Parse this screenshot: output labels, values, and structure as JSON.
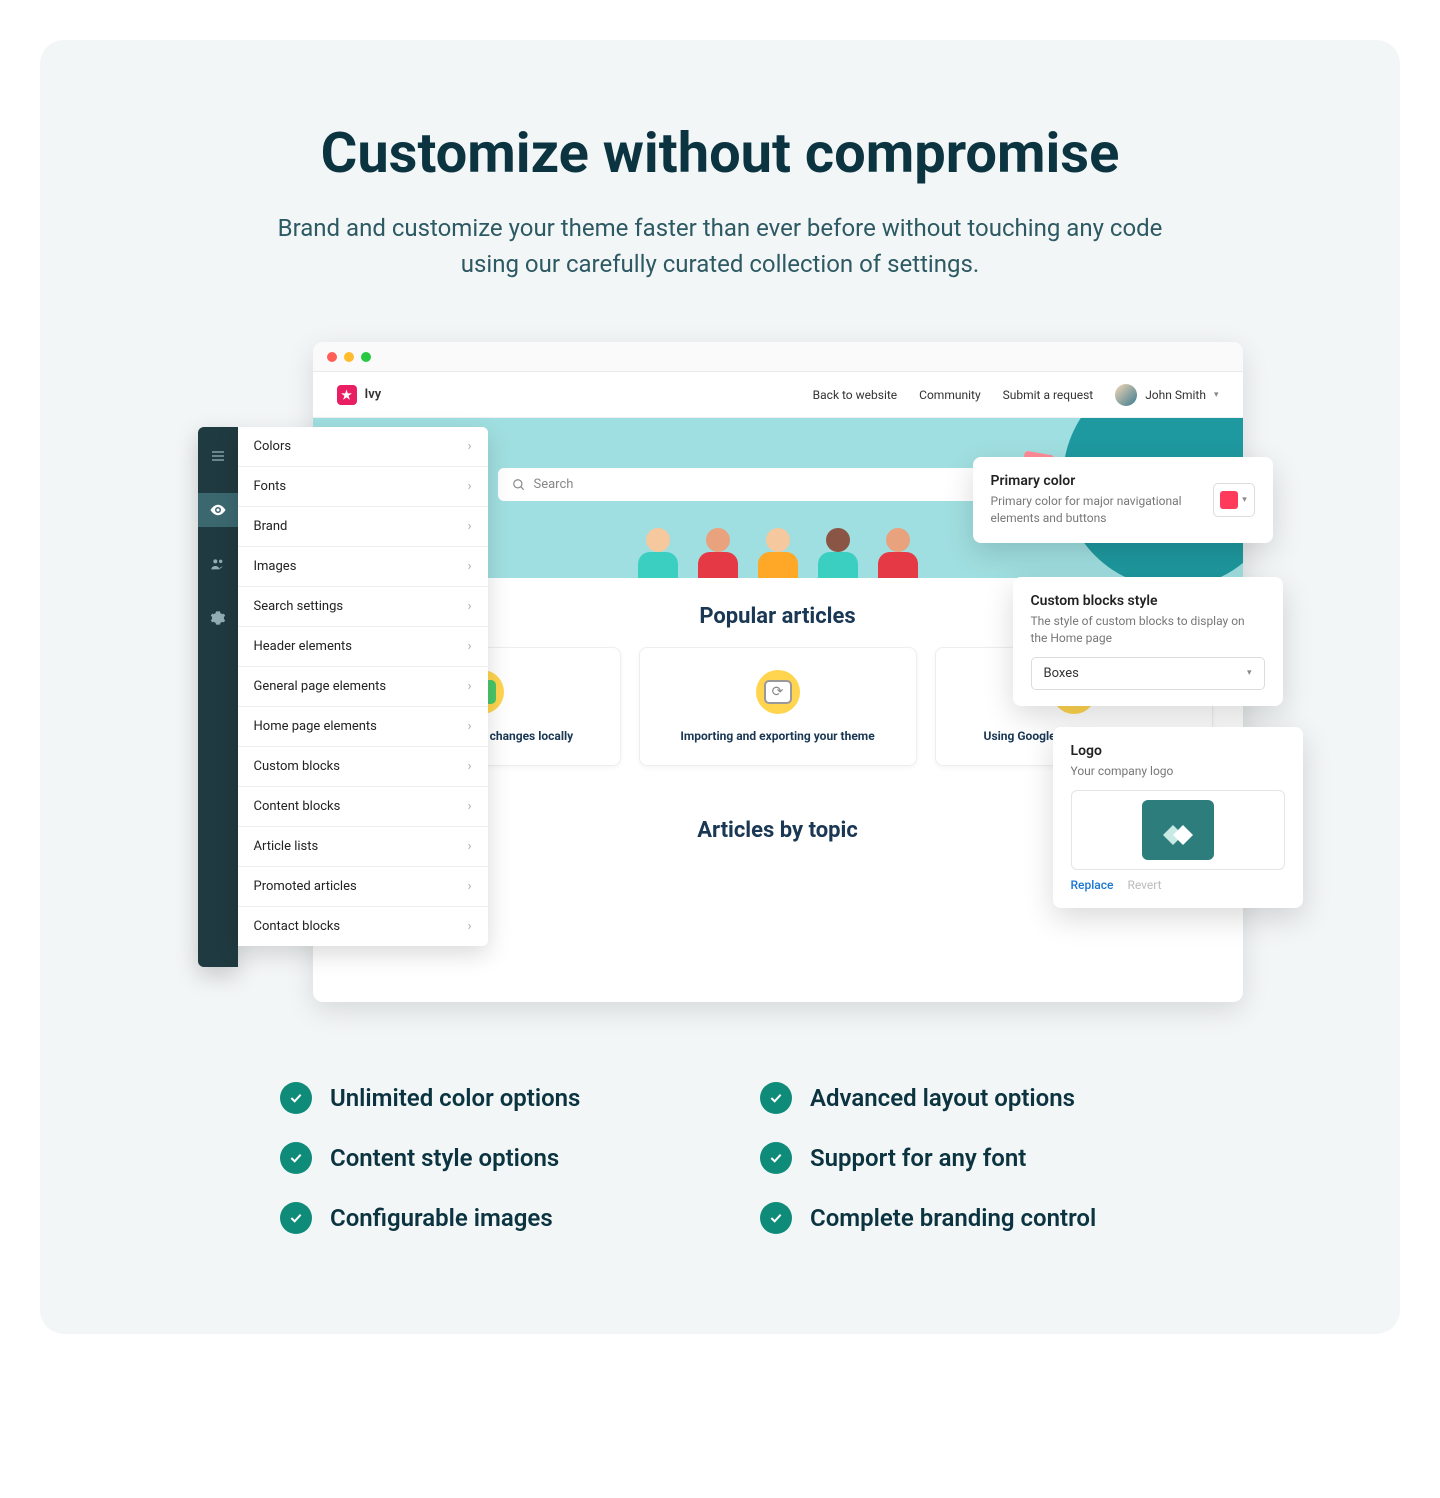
{
  "hero": {
    "title": "Customize without compromise",
    "subtitle": "Brand and customize your theme faster than ever before without touching any code using our carefully curated collection of settings."
  },
  "browser": {
    "brand_name": "Ivy",
    "nav_links": [
      "Back to website",
      "Community",
      "Submit a request"
    ],
    "user_name": "John Smith",
    "search_placeholder": "Search",
    "section1_title": "Popular articles",
    "section2_title": "Articles by topic",
    "cards": [
      {
        "title": "Previewing theme changes locally"
      },
      {
        "title": "Importing and exporting your theme"
      },
      {
        "title": "Using Google fonts in your theme"
      }
    ]
  },
  "settings": {
    "items": [
      "Colors",
      "Fonts",
      "Brand",
      "Images",
      "Search settings",
      "Header elements",
      "General page elements",
      "Home page elements",
      "Custom blocks",
      "Content blocks",
      "Article lists",
      "Promoted articles",
      "Contact blocks"
    ]
  },
  "popovers": {
    "primary": {
      "title": "Primary color",
      "desc": "Primary color for major navigational elements and buttons",
      "swatch": "#ff3b5c"
    },
    "blocks": {
      "title": "Custom blocks style",
      "desc": "The style of custom blocks to display on the Home page",
      "selected": "Boxes"
    },
    "logo": {
      "title": "Logo",
      "desc": "Your company logo",
      "replace": "Replace",
      "revert": "Revert"
    }
  },
  "features": {
    "items": [
      "Unlimited color options",
      "Advanced layout options",
      "Content style options",
      "Support for any font",
      "Configurable images",
      "Complete branding control"
    ]
  }
}
